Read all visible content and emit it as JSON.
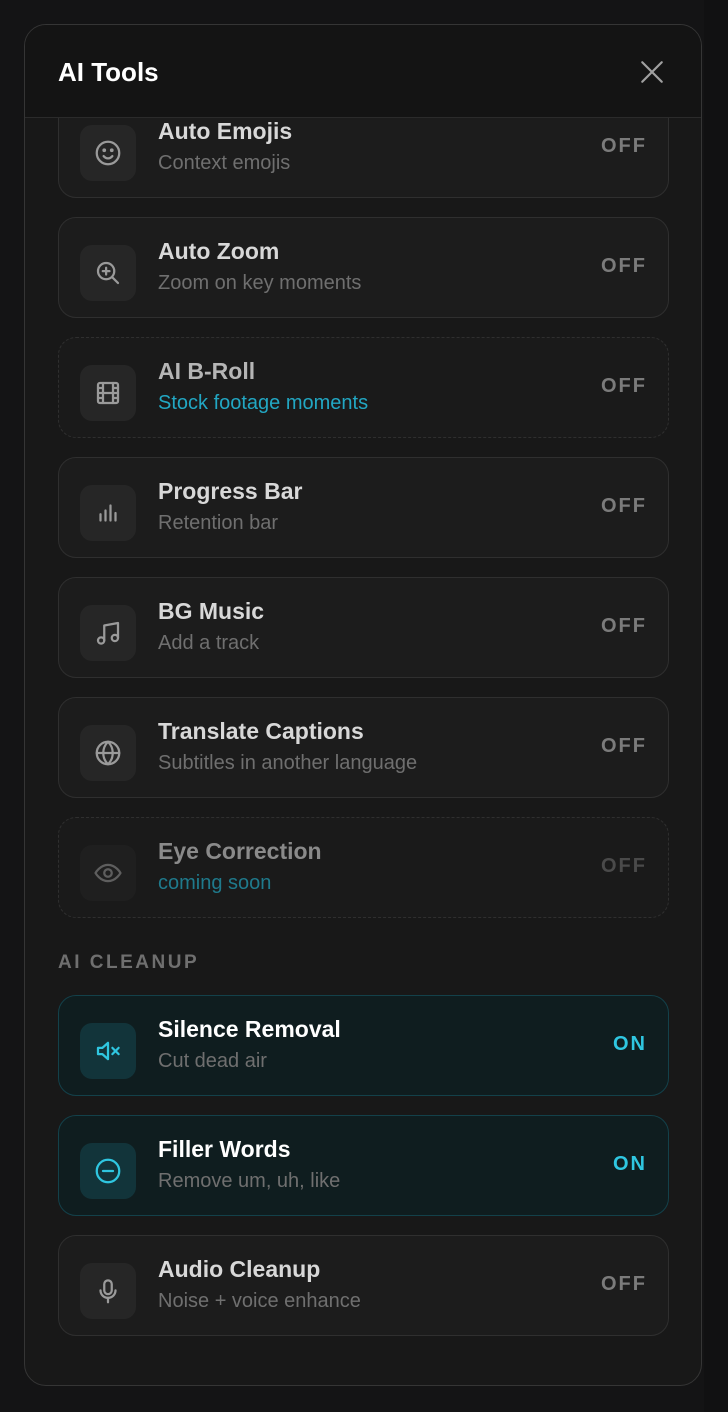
{
  "modal": {
    "title": "AI Tools"
  },
  "tools": [
    {
      "name": "Auto Emojis",
      "desc": "Context emojis",
      "state": "OFF",
      "icon": "smile-icon"
    },
    {
      "name": "Auto Zoom",
      "desc": "Zoom on key moments",
      "state": "OFF",
      "icon": "zoom-in-icon"
    },
    {
      "name": "AI B-Roll",
      "desc": "Stock footage moments",
      "state": "OFF",
      "icon": "film-icon"
    },
    {
      "name": "Progress Bar",
      "desc": "Retention bar",
      "state": "OFF",
      "icon": "bar-chart-icon"
    },
    {
      "name": "BG Music",
      "desc": "Add a track",
      "state": "OFF",
      "icon": "music-icon"
    },
    {
      "name": "Translate Captions",
      "desc": "Subtitles in another language",
      "state": "OFF",
      "icon": "globe-icon"
    },
    {
      "name": "Eye Correction",
      "desc": "coming soon",
      "state": "OFF",
      "icon": "eye-icon"
    }
  ],
  "cleanup": {
    "section_label": "AI CLEANUP",
    "items": [
      {
        "name": "Silence Removal",
        "desc": "Cut dead air",
        "state": "ON",
        "icon": "volume-mute-icon"
      },
      {
        "name": "Filler Words",
        "desc": "Remove um, uh, like",
        "state": "ON",
        "icon": "minus-circle-icon"
      },
      {
        "name": "Audio Cleanup",
        "desc": "Noise + voice enhance",
        "state": "OFF",
        "icon": "microphone-icon"
      }
    ]
  },
  "colors": {
    "accent": "#2fc6e0",
    "background": "#181818",
    "card": "#1c1c1c"
  }
}
